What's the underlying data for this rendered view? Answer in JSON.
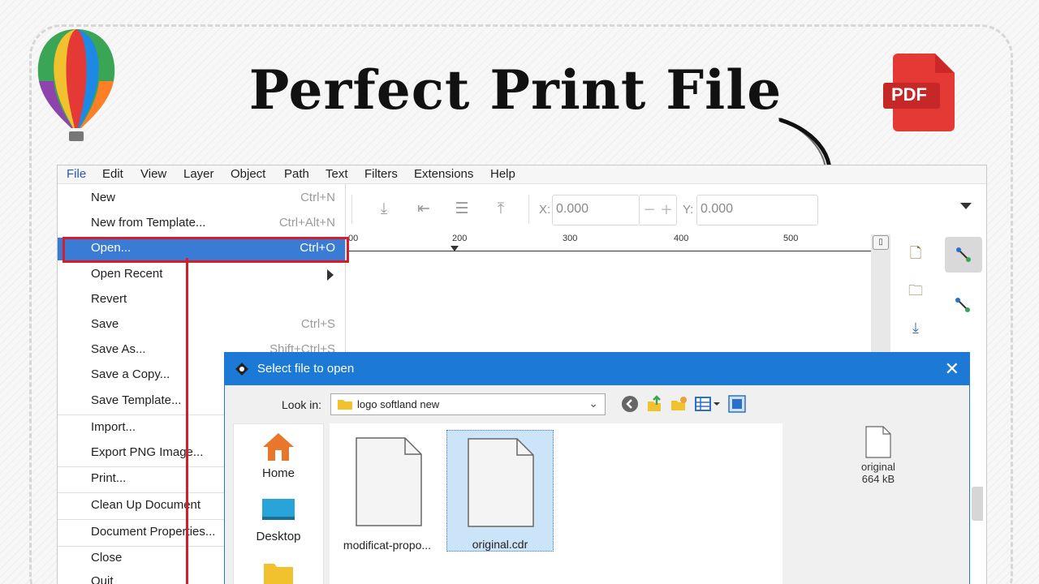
{
  "headline": "Perfect Print File",
  "pdf_badge": "PDF",
  "menubar": [
    "File",
    "Edit",
    "View",
    "Layer",
    "Object",
    "Path",
    "Text",
    "Filters",
    "Extensions",
    "Help"
  ],
  "toolbar": {
    "x_label": "X:",
    "x_value": "0.000",
    "y_label": "Y:",
    "y_value": "0.000",
    "minus": "−",
    "plus": "+"
  },
  "ruler": [
    "00",
    "200",
    "300",
    "400",
    "500"
  ],
  "file_menu": [
    {
      "label": "New",
      "shortcut": "Ctrl+N"
    },
    {
      "label": "New from Template...",
      "shortcut": "Ctrl+Alt+N"
    },
    {
      "label": "Open...",
      "shortcut": "Ctrl+O",
      "highlighted": true
    },
    {
      "label": "Open Recent",
      "shortcut": "",
      "submenu": true
    },
    {
      "label": "Revert",
      "shortcut": ""
    },
    {
      "label": "Save",
      "shortcut": "Ctrl+S"
    },
    {
      "label": "Save As...",
      "shortcut": "Shift+Ctrl+S"
    },
    {
      "label": "Save a Copy...",
      "shortcut": ""
    },
    {
      "label": "Save Template...",
      "shortcut": ""
    },
    {
      "label": "Import...",
      "shortcut": ""
    },
    {
      "label": "Export PNG Image...",
      "shortcut": ""
    },
    {
      "label": "Print...",
      "shortcut": ""
    },
    {
      "label": "Clean Up Document",
      "shortcut": ""
    },
    {
      "label": "Document Properties...",
      "shortcut": ""
    },
    {
      "label": "Close",
      "shortcut": ""
    },
    {
      "label": "Quit",
      "shortcut": ""
    }
  ],
  "dialog": {
    "title": "Select file to open",
    "close": "✕",
    "look_in_label": "Look in:",
    "look_in_value": "logo softland new",
    "places": [
      "Home",
      "Desktop"
    ],
    "files": [
      {
        "name": "modificat-propo...",
        "selected": false
      },
      {
        "name": "original.cdr",
        "selected": true
      }
    ],
    "preview": {
      "name": "original",
      "size": "664 kB"
    }
  },
  "colors": {
    "highlight": "#3a7bd5",
    "annotation_red": "#d21f2a",
    "dialog_title": "#1c7ad6",
    "pdf_red": "#e53935"
  }
}
